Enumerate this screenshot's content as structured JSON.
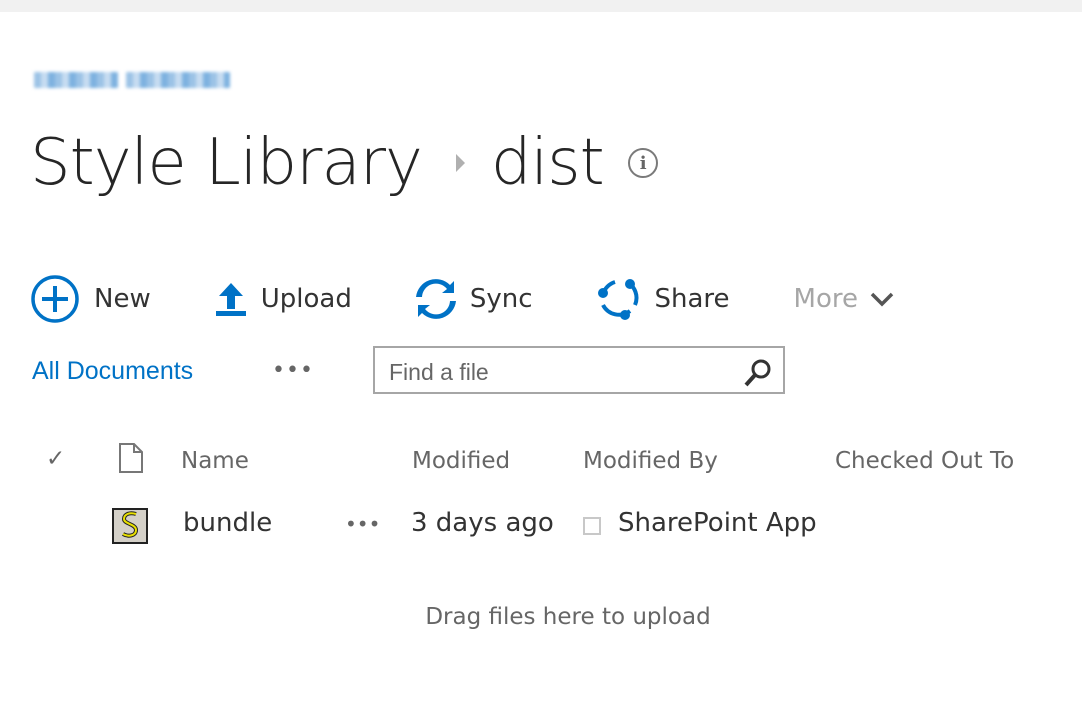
{
  "breadcrumb": {
    "site_link_obscured": true,
    "library": "Style Library",
    "folder": "dist",
    "separator_icon": "caret-right-icon",
    "info_icon": "info-circle-icon"
  },
  "commands": [
    {
      "label": "New",
      "icon": "plus-circle-icon"
    },
    {
      "label": "Upload",
      "icon": "upload-arrow-icon"
    },
    {
      "label": "Sync",
      "icon": "sync-icon"
    },
    {
      "label": "Share",
      "icon": "share-icon"
    },
    {
      "label": "More",
      "icon": "chevron-down-icon",
      "disabled": true
    }
  ],
  "view": {
    "name": "All Documents",
    "ellipsis": "•••"
  },
  "search": {
    "placeholder": "Find a file",
    "value": ""
  },
  "columns": {
    "select": "✓",
    "type_icon": "document-icon",
    "name": "Name",
    "modified": "Modified",
    "modified_by": "Modified By",
    "checked_out_to": "Checked Out To"
  },
  "files": [
    {
      "name": "bundle",
      "icon": "js-file-icon",
      "menu": "•••",
      "modified": "3 days ago",
      "modified_by": "SharePoint App",
      "checked_out_to": ""
    }
  ],
  "drop_hint": "Drag files here to upload",
  "colors": {
    "accent": "#0072c6",
    "text": "#333333",
    "muted": "#666666",
    "disabled": "#a6a6a6",
    "title": "#262626"
  }
}
